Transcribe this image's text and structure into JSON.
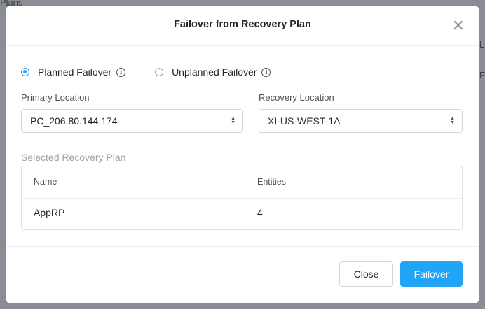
{
  "background": {
    "left_text": "Plans",
    "right_text_1": "L",
    "right_text_2": "F"
  },
  "modal": {
    "title": "Failover from Recovery Plan",
    "failover_type": {
      "options": [
        {
          "label": "Planned Failover",
          "checked": true
        },
        {
          "label": "Unplanned Failover",
          "checked": false
        }
      ]
    },
    "primary_location": {
      "label": "Primary Location",
      "value": "PC_206.80.144.174"
    },
    "recovery_location": {
      "label": "Recovery Location",
      "value": "XI-US-WEST-1A"
    },
    "selected_plan": {
      "label": "Selected Recovery Plan",
      "columns": [
        "Name",
        "Entities"
      ],
      "rows": [
        [
          "AppRP",
          "4"
        ]
      ]
    },
    "buttons": {
      "close": "Close",
      "failover": "Failover"
    }
  },
  "colors": {
    "accent": "#22a5f7",
    "overlay": "#8a8d91"
  }
}
